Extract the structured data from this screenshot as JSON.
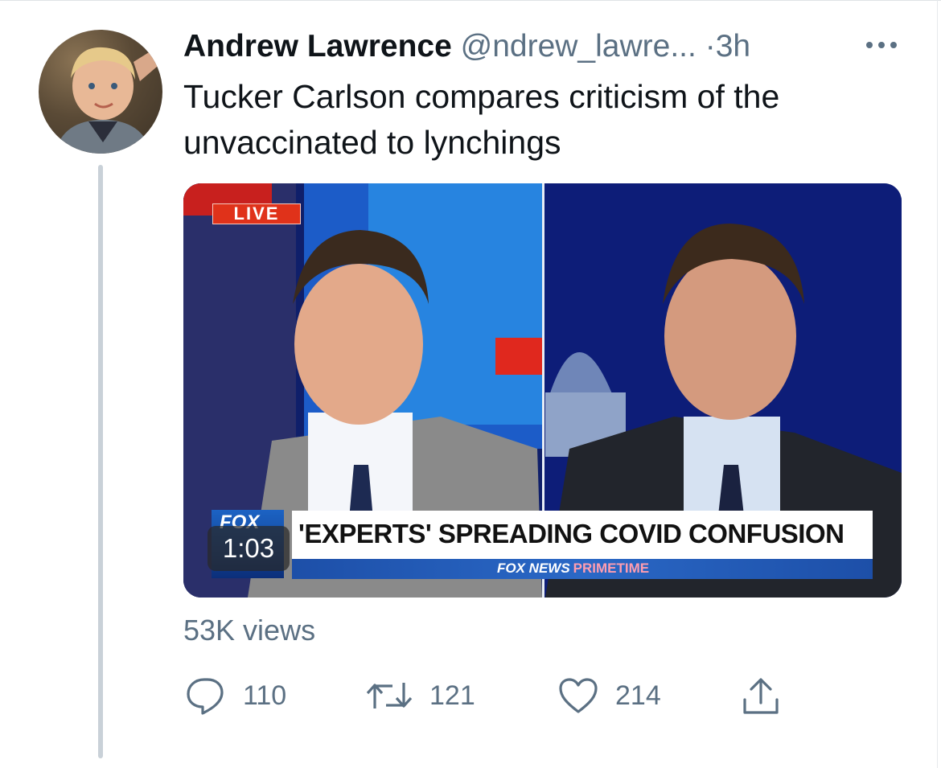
{
  "tweet": {
    "author_name": "Andrew Lawrence",
    "handle": "@ndrew_lawre...",
    "separator": "·",
    "time": "3h",
    "text": "Tucker Carlson compares criticism of the unvaccinated to lynchings",
    "views": "53K views"
  },
  "video": {
    "live_badge": "LIVE",
    "chyron_headline": "'EXPERTS' SPREADING COVID CONFUSION",
    "network_brand": "FOX NEWS",
    "network_show": "PRIMETIME",
    "logo_text": "FOX",
    "duration": "1:03"
  },
  "actions": {
    "replies": "110",
    "retweets": "121",
    "likes": "214"
  },
  "colors": {
    "secondary_text": "#5b7083",
    "live_red": "#e0321a",
    "fox_blue": "#1d4fa8"
  }
}
